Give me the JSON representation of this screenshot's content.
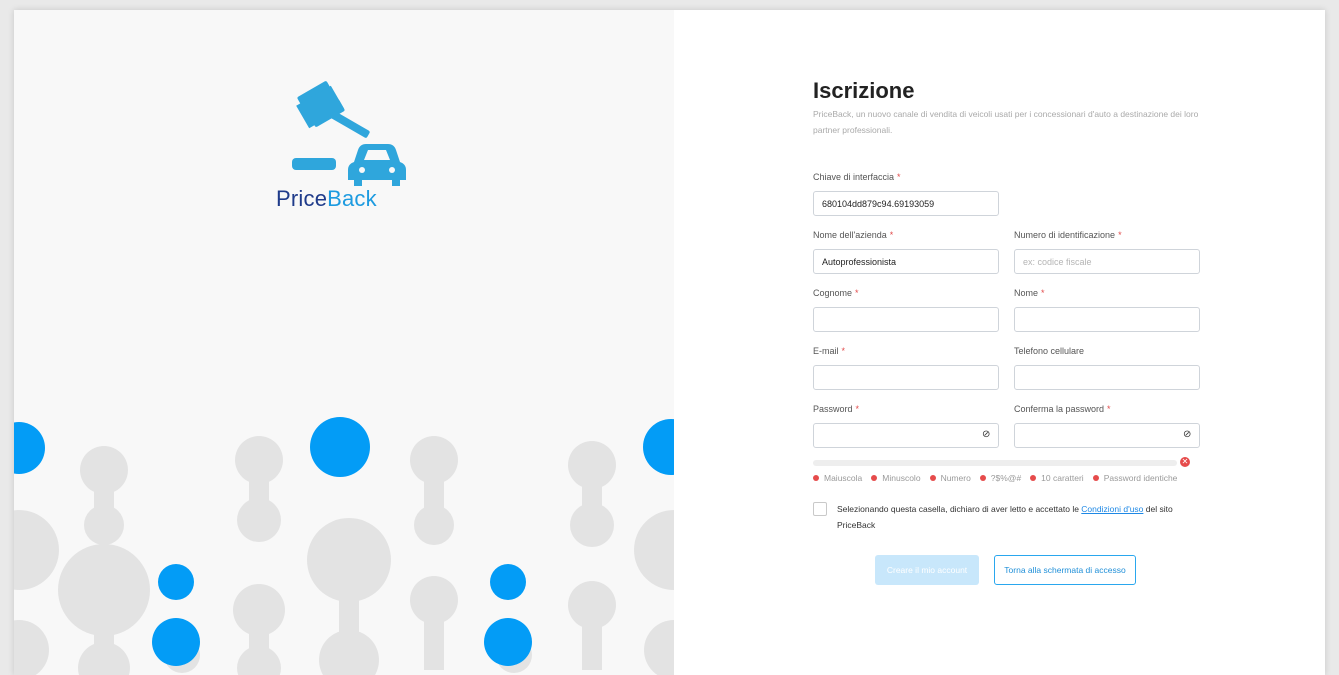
{
  "brand": {
    "part1": "Price",
    "part2": "Back"
  },
  "colors": {
    "accent": "#1d9be0",
    "brand_dark": "#1f3b8a",
    "error": "#e64b4b",
    "pattern_grey": "#e3e3e3",
    "pattern_blue": "#039cf6"
  },
  "form": {
    "title": "Iscrizione",
    "subtitle": "PriceBack, un nuovo canale di vendita di veicoli usati per i concessionari d'auto a destinazione dei loro partner professionali.",
    "required_mark": "*",
    "fields": {
      "interface_key": {
        "label": "Chiave di interfaccia",
        "value": "680104dd879c94.69193059"
      },
      "company_name": {
        "label": "Nome dell'azienda",
        "value": "Autoprofessionista"
      },
      "id_number": {
        "label": "Numero di identificazione",
        "placeholder": "ex: codice fiscale"
      },
      "last_name": {
        "label": "Cognome",
        "value": ""
      },
      "first_name": {
        "label": "Nome",
        "value": ""
      },
      "email": {
        "label": "E-mail",
        "value": ""
      },
      "mobile": {
        "label": "Telefono cellulare",
        "value": ""
      },
      "password": {
        "label": "Password",
        "value": ""
      },
      "confirm_password": {
        "label": "Conferma la password",
        "value": ""
      }
    },
    "password_rules": [
      "Maiuscola",
      "Minuscolo",
      "Numero",
      "?$%@#",
      "10 caratteri",
      "Password identiche"
    ],
    "terms": {
      "before": "Selezionando questa casella, dichiaro di aver letto e accettato le ",
      "link": "Condizioni d'uso",
      "after": " del sito PriceBack"
    },
    "buttons": {
      "create": "Creare il mio account",
      "back": "Torna alla schermata di accesso"
    }
  }
}
